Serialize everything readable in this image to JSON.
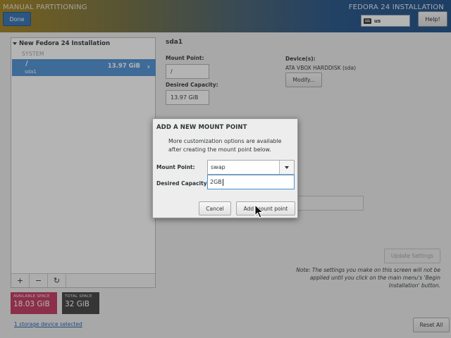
{
  "header": {
    "spoke_title": "MANUAL PARTITIONING",
    "done_label": "Done",
    "product_title": "FEDORA 24 INSTALLATION",
    "keyboard_layout": "us",
    "help_label": "Help!"
  },
  "partition_list": {
    "install_title": "New Fedora 24 Installation",
    "section_label": "SYSTEM",
    "selected_partition": {
      "mount_point": "/",
      "device": "sda1",
      "size": "13.97 GiB"
    },
    "toolbar": {
      "add_label": "+",
      "remove_label": "−",
      "refresh_label": "↻"
    }
  },
  "space": {
    "available_label": "AVAILABLE SPACE",
    "available_value": "18.03 GiB",
    "total_label": "TOTAL SPACE",
    "total_value": "32 GiB"
  },
  "storage_link": "1 storage device selected",
  "details": {
    "selected_title": "sda1",
    "mount_point_label": "Mount Point:",
    "mount_point_value": "/",
    "desired_capacity_label": "Desired Capacity:",
    "desired_capacity_value": "13.97 GiB",
    "devices_label": "Device(s):",
    "device_name": "ATA VBOX HARDDISK (sda)",
    "modify_label": "Modify...",
    "update_label": "Update Settings",
    "note": "Note:  The settings you make on this screen will not be applied until you click on the main menu's 'Begin Installation' button.",
    "reset_label": "Reset All"
  },
  "dialog": {
    "title": "ADD A NEW MOUNT POINT",
    "description": "More customization options are available after creating the mount point below.",
    "mount_point_label": "Mount Point:",
    "mount_point_value": "swap",
    "capacity_label": "Desired Capacity:",
    "capacity_value": "2GB",
    "cancel_label": "Cancel",
    "add_label": "Add mount point"
  },
  "colors": {
    "selection_blue": "#4a8fd5",
    "available_space": "#c0335d",
    "total_space": "#3c3c3c",
    "done_button": "#2f6fb3"
  }
}
